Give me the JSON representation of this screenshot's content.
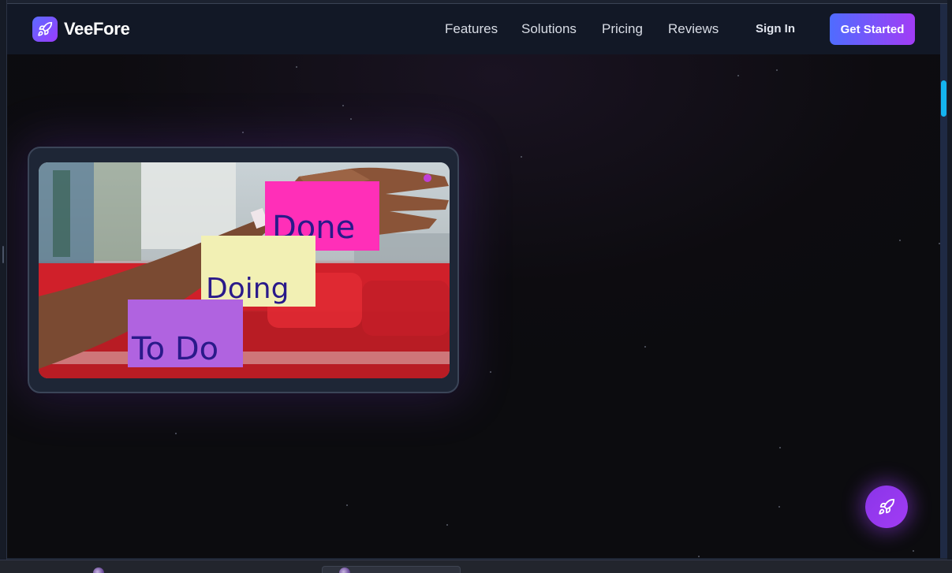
{
  "brand": {
    "name": "VeeFore",
    "logo_icon": "rocket-icon"
  },
  "nav": {
    "links": [
      "Features",
      "Solutions",
      "Pricing",
      "Reviews"
    ],
    "sign_in": "Sign In",
    "cta": "Get Started"
  },
  "hero_image": {
    "notes": [
      "Done",
      "Doing",
      "To Do"
    ],
    "note_colors": [
      "#ff2fb8",
      "#f2f0b4",
      "#b063e0"
    ]
  },
  "fab": {
    "icon": "rocket-icon"
  },
  "colors": {
    "accent_start": "#4f6cff",
    "accent_end": "#a23cf5",
    "nav_bg": "#121826",
    "scroll_thumb": "#14b4f0"
  }
}
